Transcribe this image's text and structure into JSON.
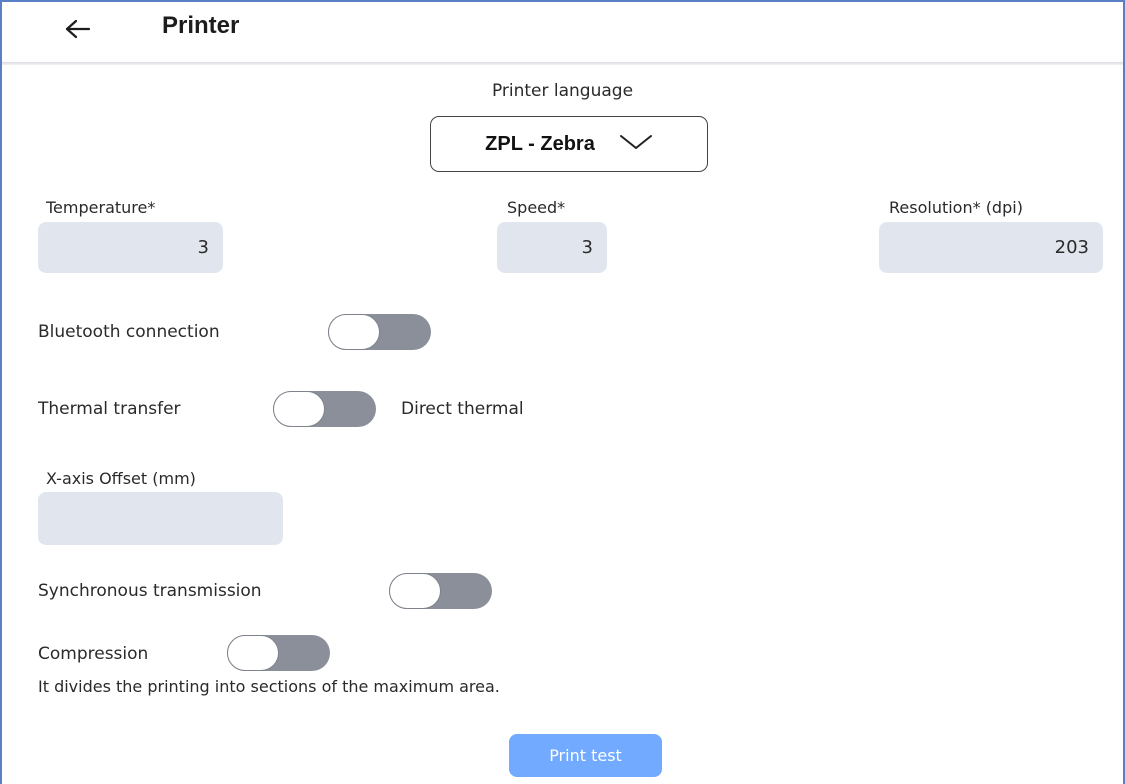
{
  "header": {
    "back_icon": "arrow-left-icon",
    "title": "Printer"
  },
  "printer_language": {
    "label": "Printer language",
    "selected": "ZPL - Zebra",
    "chevron_icon": "chevron-down-icon"
  },
  "fields": {
    "temperature": {
      "label": "Temperature*",
      "value": "3"
    },
    "speed": {
      "label": "Speed*",
      "value": "3"
    },
    "resolution": {
      "label": "Resolution* (dpi)",
      "value": "203"
    },
    "x_offset": {
      "label": "X-axis Offset (mm)",
      "value": ""
    }
  },
  "toggles": {
    "bluetooth": {
      "label": "Bluetooth connection",
      "on": false
    },
    "thermal": {
      "left_label": "Thermal transfer",
      "right_label": "Direct thermal",
      "on": false
    },
    "sync": {
      "label": "Synchronous transmission",
      "on": false
    },
    "compression": {
      "label": "Compression",
      "on": false,
      "hint": "It divides the printing into sections of the maximum area."
    }
  },
  "print_test": {
    "label": "Print test"
  },
  "colors": {
    "frame": "#5b7fc7",
    "input_bg": "#e1e6ee",
    "toggle_track": "#8b8f99",
    "button": "#72aaff"
  }
}
